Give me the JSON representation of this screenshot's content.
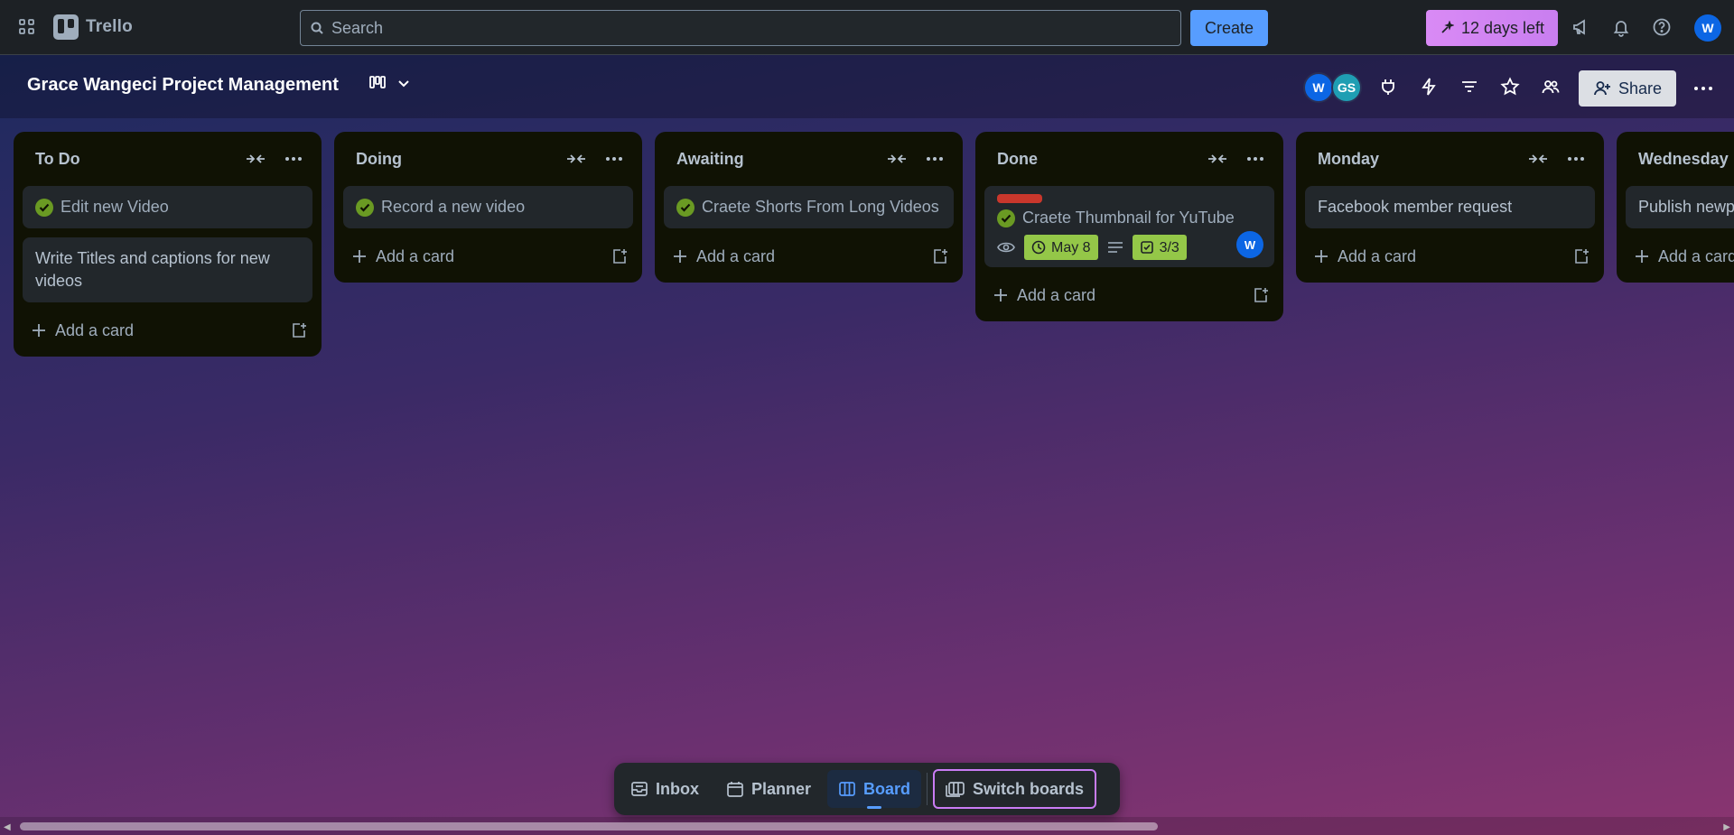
{
  "topnav": {
    "app_name": "Trello",
    "search": {
      "placeholder": "Search"
    },
    "create_label": "Create",
    "trial_label": "12 days left",
    "user_initial": "W"
  },
  "board": {
    "title": "Grace Wangeci Project Management",
    "members": [
      "W",
      "GS"
    ],
    "share_label": "Share"
  },
  "lists": [
    {
      "title": "To Do",
      "cards": [
        {
          "text": "Edit new Video",
          "done": true
        },
        {
          "text": "Write Titles and captions for new videos",
          "done": false
        }
      ],
      "add_label": "Add a card"
    },
    {
      "title": "Doing",
      "cards": [
        {
          "text": "Record a new video",
          "done": true
        }
      ],
      "add_label": "Add a card"
    },
    {
      "title": "Awaiting",
      "cards": [
        {
          "text": "Craete Shorts From Long Videos",
          "done": true
        }
      ],
      "add_label": "Add a card"
    },
    {
      "title": "Done",
      "cards": [
        {
          "text": "Craete Thumbnail for YuTube",
          "done": true,
          "label_color": "#C9372C",
          "due": "May 8",
          "checklist": "3/3",
          "member": "W"
        }
      ],
      "add_label": "Add a card"
    },
    {
      "title": "Monday",
      "cards": [
        {
          "text": "Facebook member request",
          "done": false
        }
      ],
      "add_label": "Add a card"
    },
    {
      "title": "Wednesday",
      "cards": [
        {
          "text": "Publish newp",
          "done": false
        }
      ],
      "add_label": "Add a card"
    }
  ],
  "dock": {
    "inbox": "Inbox",
    "planner": "Planner",
    "board": "Board",
    "switch": "Switch boards"
  },
  "colors": {
    "accent": "#579DFF",
    "trial": "#C97EF0",
    "done_check": "#6A9A23",
    "badge_green": "#94C748"
  }
}
